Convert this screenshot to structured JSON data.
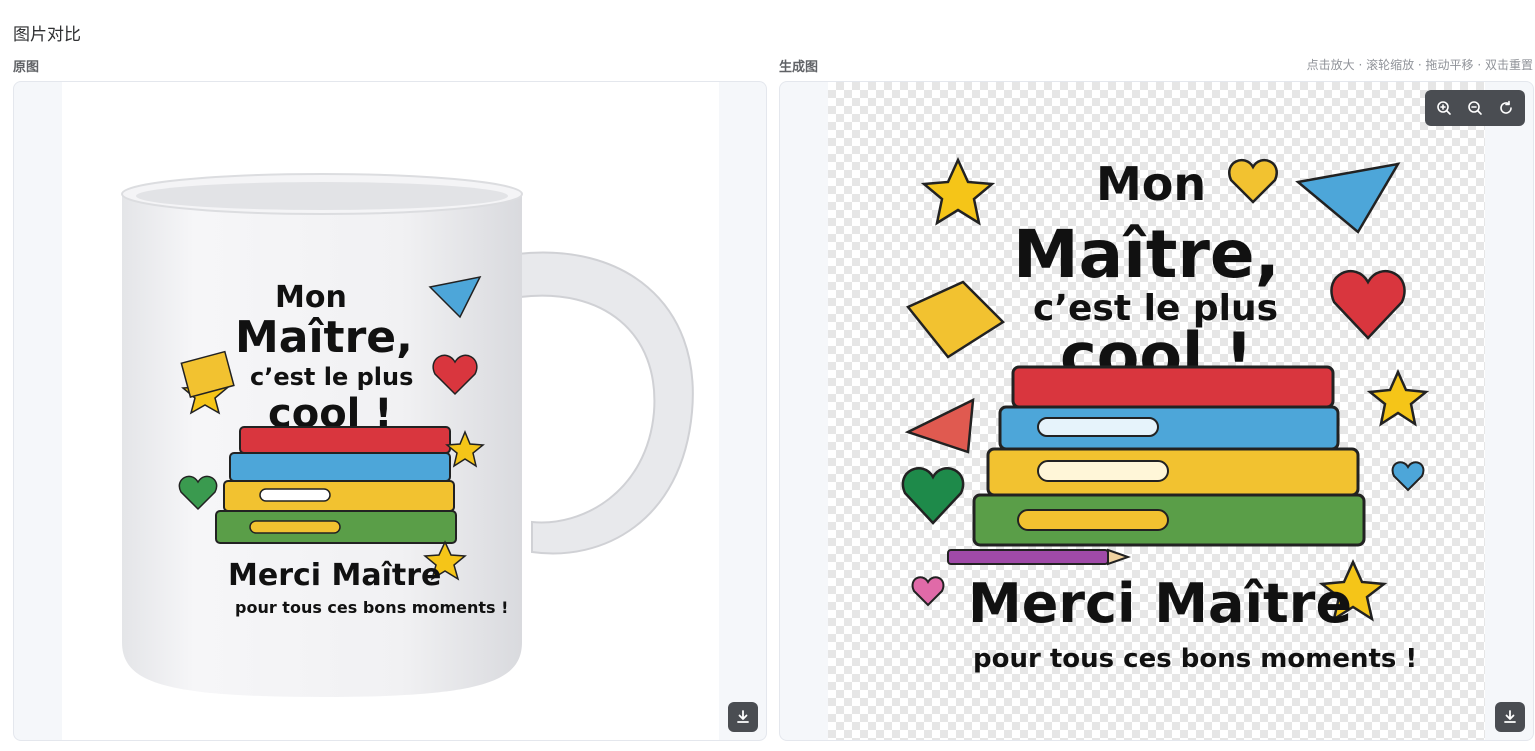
{
  "page": {
    "title": "图片对比"
  },
  "original": {
    "label": "原图"
  },
  "generated": {
    "label": "生成图",
    "hint": "点击放大 · 滚轮缩放 · 拖动平移 · 双击重置"
  },
  "artwork": {
    "line1": "Mon",
    "line2": "Maître,",
    "line3": "c’est le plus",
    "line4": "cool !",
    "line5": "Merci Maître",
    "line6": "pour tous ces bons moments !"
  },
  "colors": {
    "panel_bg": "#f5f7fa",
    "toolbar_bg": "#4a4d52",
    "book_red": "#d9363e",
    "book_blue": "#4da6d9",
    "book_yellow": "#f2c230",
    "book_green": "#5a9e48",
    "star": "#f5c518"
  },
  "icons": [
    "zoom-in-icon",
    "zoom-out-icon",
    "reset-icon",
    "download-icon"
  ]
}
